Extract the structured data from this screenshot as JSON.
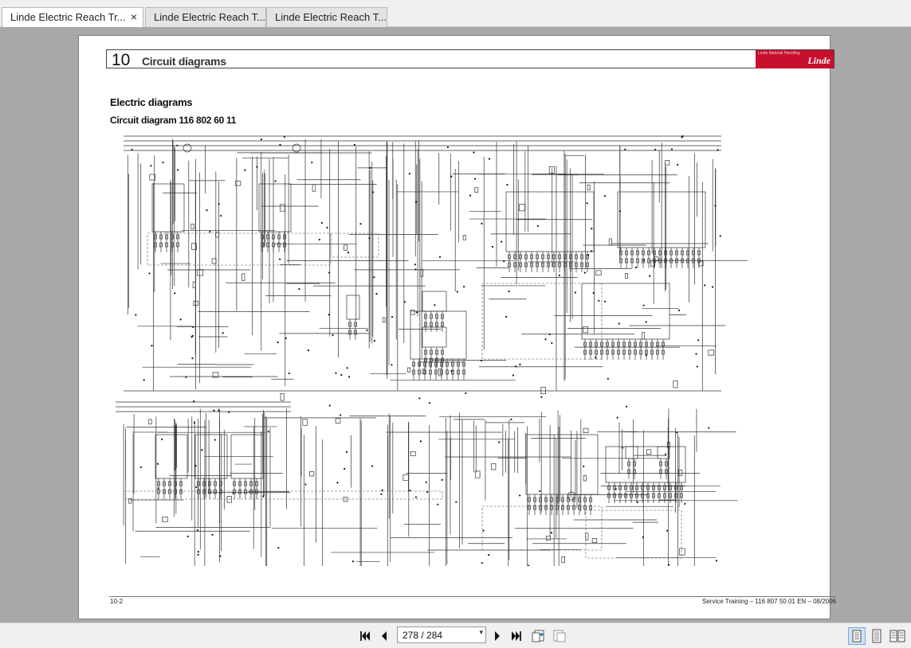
{
  "tabs": [
    {
      "label": "Linde Electric Reach Tr...",
      "close": "×",
      "active": true
    },
    {
      "label": "Linde Electric Reach T...",
      "active": false
    },
    {
      "label": "Linde Electric Reach T...",
      "active": false
    }
  ],
  "document": {
    "chapter_number": "10",
    "chapter_title": "Circuit diagrams",
    "logo_tagline": "Linde Material Handling",
    "logo_word": "Linde",
    "section_title": "Electric diagrams",
    "subsection_title": "Circuit diagram 116 802 60 11",
    "footer_page": "10-2",
    "footer_right": "Service Training – 116 807 50 01 EN – 08/2006"
  },
  "toolbar": {
    "page_indicator": "278 / 284",
    "dropdown_arrow": "▾"
  },
  "icons": {
    "first": "first-page-icon",
    "prev": "previous-page-icon",
    "next": "next-page-icon",
    "last": "last-page-icon",
    "dropdown": "chevron-down-icon",
    "close": "close-icon"
  },
  "colors": {
    "brand_red": "#c8102e",
    "viewer_bg": "#a9a9a9"
  }
}
